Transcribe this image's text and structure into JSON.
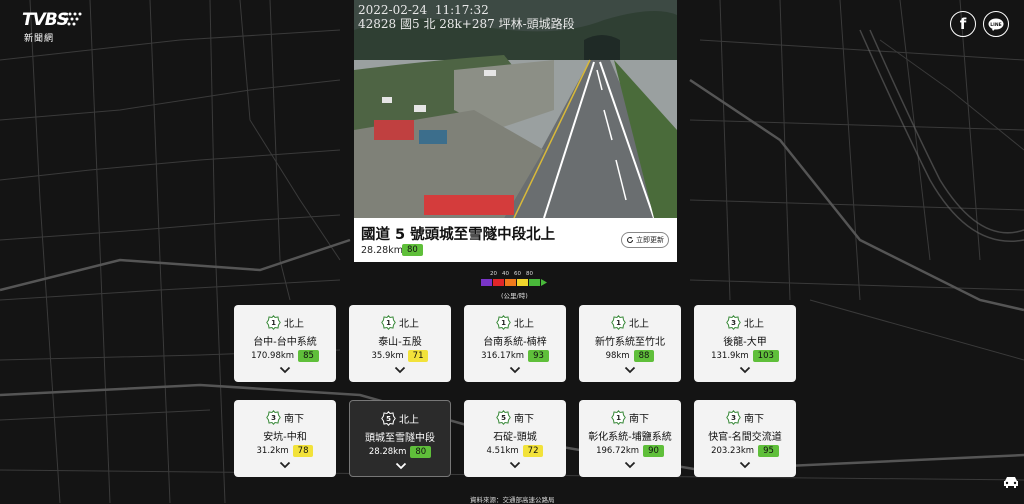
{
  "logo": {
    "main": "TVBS",
    "sub": "新聞網"
  },
  "social": {
    "facebook": "f",
    "line": "LINE"
  },
  "camera": {
    "overlay_line1": "2022-02-24  11:17:32",
    "overlay_line2": "42828 國5 北 28k+287 坪林-頭城路段",
    "title": "國道 5 號頭城至雪隧中段北上",
    "distance": "28.28km",
    "speed": "80",
    "refresh_label": "立即更新"
  },
  "legend": {
    "ticks": [
      "20",
      "40",
      "60",
      "80"
    ],
    "colors": [
      "#7a35c8",
      "#e0262a",
      "#f07a1c",
      "#f0d52c",
      "#49b93a"
    ],
    "unit": "(公里/時)"
  },
  "routes": [
    {
      "num": "1",
      "dir": "北上",
      "name": "台中-台中系統",
      "distance": "170.98km",
      "speed": "85",
      "speed_color": "green",
      "active": false
    },
    {
      "num": "1",
      "dir": "北上",
      "name": "泰山-五股",
      "distance": "35.9km",
      "speed": "71",
      "speed_color": "yellow",
      "active": false
    },
    {
      "num": "1",
      "dir": "北上",
      "name": "台南系統-楠梓",
      "distance": "316.17km",
      "speed": "93",
      "speed_color": "green",
      "active": false
    },
    {
      "num": "1",
      "dir": "北上",
      "name": "新竹系統至竹北",
      "distance": "98km",
      "speed": "88",
      "speed_color": "green",
      "active": false
    },
    {
      "num": "3",
      "dir": "北上",
      "name": "後龍-大甲",
      "distance": "131.9km",
      "speed": "103",
      "speed_color": "green",
      "active": false
    },
    {
      "num": "3",
      "dir": "南下",
      "name": "安坑-中和",
      "distance": "31.2km",
      "speed": "78",
      "speed_color": "yellow",
      "active": false
    },
    {
      "num": "5",
      "dir": "北上",
      "name": "頭城至雪隧中段",
      "distance": "28.28km",
      "speed": "80",
      "speed_color": "green",
      "active": true
    },
    {
      "num": "5",
      "dir": "南下",
      "name": "石碇-頭城",
      "distance": "4.51km",
      "speed": "72",
      "speed_color": "yellow",
      "active": false
    },
    {
      "num": "1",
      "dir": "南下",
      "name": "彰化系統-埔鹽系統",
      "distance": "196.72km",
      "speed": "90",
      "speed_color": "green",
      "active": false
    },
    {
      "num": "3",
      "dir": "南下",
      "name": "快官-名間交流道",
      "distance": "203.23km",
      "speed": "95",
      "speed_color": "green",
      "active": false
    }
  ],
  "source": "資料來源：交通部高速公路局",
  "icons": {
    "car": "car-icon",
    "chevron": "chevron-down-icon",
    "shield": "highway-shield-icon"
  }
}
